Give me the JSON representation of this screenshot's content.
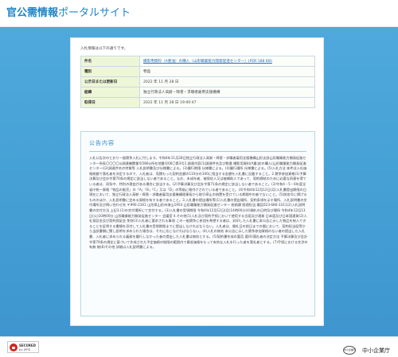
{
  "header": {
    "title_bold": "官公需情報",
    "title_light": "ポータルサイト"
  },
  "card": {
    "intro": "入札情報は以下の通りです。",
    "rows": [
      {
        "label": "件名",
        "value": "撮影用資料（A重油）の購入（山形職業能力開発促進センター）(PDF:188 KB)"
      },
      {
        "label": "種別",
        "value": "物品"
      },
      {
        "label": "公示日または更新日",
        "value": "2022 年 11 月 28 日"
      },
      {
        "label": "組織",
        "value": "独立行政法人高齢・障害・求職者雇用支援機構"
      },
      {
        "label": "取得日",
        "value": "2022 年 11 月 28 日 19:00:47"
      }
    ]
  },
  "notice": {
    "title": "公告内容",
    "body": "入札公告次のとおり一般競争入札に付します。令和4年11月28日独立行政法人高齢・障害・求職者雇用支援機構山形支部山形職業能力開発促進センター所長〇〇〇〇◎調達機関番号586◎所在地番号06〇第3号1.調達内容(1)調達件名及び数量 撮影用資料(A重油)の購入(山形職業能力開発促進センター)(2)調達件名の特質等 入札説明書及び仕様書による。(3)履行期限 仕様書による。(4)履行場所 仕様書による。(5)入札方法 本件は入札価格総額で落札者を決定するので、入札者は、見積もった契約金額の110分の100に相当する金額を入札書に記載すること。2.競争参加資格(1)予算決算及び会計令第70条の規定に該当しない者であること。なお、未成年者、被保佐人又は被補助人であって、契約締結のために必要な同意を得ている者は、同条中、特別の理由がある場合に該当する。(2)予算決算及び会計令第71条の規定に該当しない者であること。(3)令和4・5・6年度全省庁統一資格「物品の販売」の「A」「B」「C」又は「D」の等級に格付けされている者であること。(4)令和4年12月12日(月)入札書提出期限の日現在において、独立行政法人高齢・障害・求職者雇用支援機構理事長から取引停止の措置を受けている期間中の者でないこと。(5)前各号に掲げるもののほか、入札説明書に定める資格を有する者であること。3.入札書の提出場所等(1)入札書の提出場所、契約条項を示す場所、入札説明書の交付場所及び問い合わせ先 〒990-2161 山形県山形市漆山1954 山形職業能力開発促進センター 総務課 経理担当 電話023-686-3311(2)入札説明書の交付方法 上記3.(1)の交付場所にて交付する。(3)入札書の受領期限 令和4年12月12日(月)14時00分(4)開札の日時及び場所 令和4年12月13日(火)10時00分 山形職業能力開発促進センター 会議室 4.その他(1)入札及び契約手続において使用する言語及び通貨 日本語及び日本国通貨(2)入札保証金及び契約保証金 免除(3)入札者に要求される事項 この一般競争に参加を希望する者は、封印した入札書に本公告に示した物品を納入できることを証明する書類を添付して入札書の受領期限までに提出しなければならない。入札者は、開札日の前日までの間において、契約担当役等から当該書類に関し説明を求められた場合は、それに応じなければならない。(4)入札の無効 本公告に示した競争参加資格のない者の提出した入札書、入札者に求められる義務を履行しなかった者の提出した入札書は無効とする。(5)契約書作成の要否 要(6)落札者の決定方法 予算決算及び会計令第79条の規定に基づいて作成された予定価格の制限の範囲内で最低価格をもって有効な入札を行った者を落札者とする。(7)手続における交渉の有無 無(8)その他 詳細は入札説明書による。"
  },
  "footer": {
    "secured_line1": "SECURED",
    "secured_line2": "by JPRS",
    "emblem_text": "中小企業庁",
    "org_name": "中小企業庁"
  }
}
